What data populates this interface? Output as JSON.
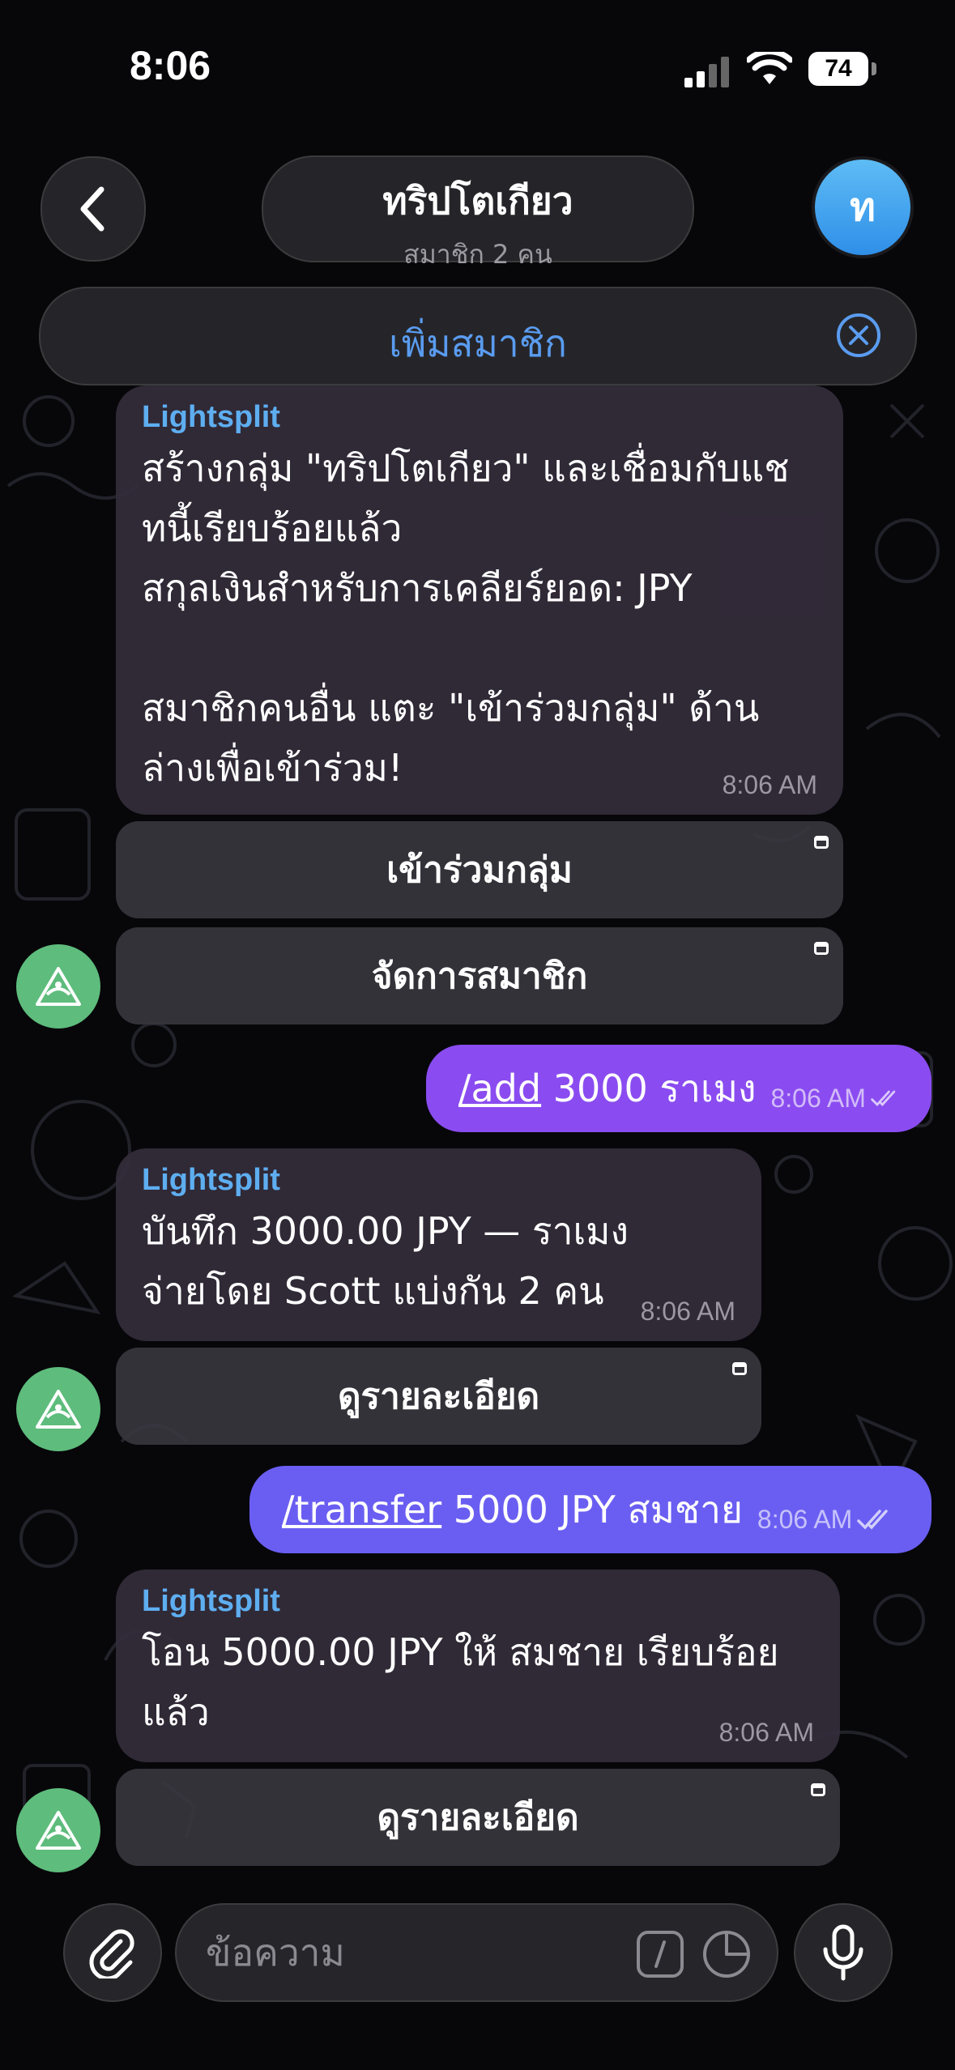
{
  "status_bar": {
    "time": "8:06",
    "battery": "74"
  },
  "header": {
    "title": "ทริปโตเกียว",
    "subtitle": "สมาชิก 2 คน",
    "avatar_letter": "ท",
    "back_icon": "chevron-left-icon"
  },
  "banner": {
    "label": "เพิ่มสมาชิก",
    "close_icon": "close-circle-icon"
  },
  "messages": [
    {
      "sender": "Lightsplit",
      "text": "สร้างกลุ่ม \"ทริปโตเกียว\" และเชื่อมกับแช\nทนี้เรียบร้อยแล้ว\nสกุลเงินสำหรับการเคลียร์ยอด: JPY\n\nสมาชิกคนอื่น แตะ \"เข้าร่วมกลุ่ม\" ด้าน\nล่างเพื่อเข้าร่วม!",
      "time": "8:06 AM",
      "buttons": [
        "เข้าร่วมกลุ่ม",
        "จัดการสมาชิก"
      ]
    },
    {
      "command": "/add",
      "rest": " 3000 ราเมง",
      "time": "8:06 AM",
      "color": "#8a4cf0"
    },
    {
      "sender": "Lightsplit",
      "text": "บันทึก 3000.00 JPY — ราเมง\nจ่ายโดย Scott แบ่งกัน 2 คน",
      "time": "8:06 AM",
      "buttons": [
        "ดูรายละเอียด"
      ]
    },
    {
      "command": "/transfer",
      "rest": " 5000 JPY สมชาย",
      "time": "8:06 AM",
      "color": "#6a5ef2"
    },
    {
      "sender": "Lightsplit",
      "text": "โอน 5000.00 JPY ให้ สมชาย เรียบร้อย\nแล้ว",
      "time": "8:06 AM",
      "buttons": [
        "ดูรายละเอียด"
      ]
    }
  ],
  "composer": {
    "placeholder": "ข้อความ",
    "attach_icon": "paperclip-icon",
    "command_icon": "slash-command-icon",
    "sticker_icon": "sticker-icon",
    "mic_icon": "microphone-icon"
  },
  "colors": {
    "accent": "#5a9cf0",
    "sender": "#5eaef0",
    "bot_avatar": "#5ebc7c"
  }
}
